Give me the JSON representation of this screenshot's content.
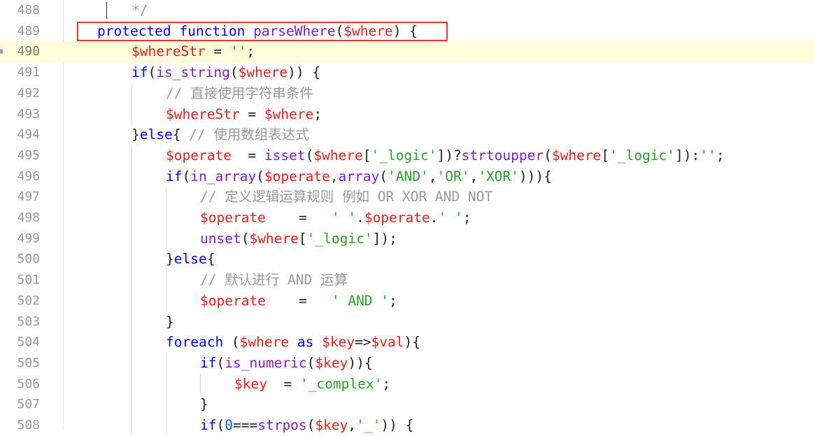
{
  "editor": {
    "current_line_index": 2,
    "lines": [
      {
        "num": "488",
        "indent": 2,
        "tokens": [
          {
            "t": "*/",
            "c": "c"
          }
        ]
      },
      {
        "num": "489",
        "indent": 1,
        "tokens": [
          {
            "t": "protected ",
            "c": "k"
          },
          {
            "t": "function ",
            "c": "k"
          },
          {
            "t": "parseWhere",
            "c": "f"
          },
          {
            "t": "(",
            "c": "p"
          },
          {
            "t": "$where",
            "c": "v"
          },
          {
            "t": ") {",
            "c": "p"
          }
        ]
      },
      {
        "num": "490",
        "indent": 2,
        "tokens": [
          {
            "t": "$whereStr",
            "c": "v"
          },
          {
            "t": " = ",
            "c": "p"
          },
          {
            "t": "''",
            "c": "s"
          },
          {
            "t": ";",
            "c": "p"
          }
        ]
      },
      {
        "num": "491",
        "indent": 2,
        "tokens": [
          {
            "t": "if",
            "c": "k"
          },
          {
            "t": "(",
            "c": "p"
          },
          {
            "t": "is_string",
            "c": "f"
          },
          {
            "t": "(",
            "c": "p"
          },
          {
            "t": "$where",
            "c": "v"
          },
          {
            "t": ")) {",
            "c": "p"
          }
        ]
      },
      {
        "num": "492",
        "indent": 3,
        "tokens": [
          {
            "t": "// 直接使用字符串条件",
            "c": "c"
          }
        ]
      },
      {
        "num": "493",
        "indent": 3,
        "tokens": [
          {
            "t": "$whereStr",
            "c": "v"
          },
          {
            "t": " = ",
            "c": "p"
          },
          {
            "t": "$where",
            "c": "v"
          },
          {
            "t": ";",
            "c": "p"
          }
        ]
      },
      {
        "num": "494",
        "indent": 2,
        "tokens": [
          {
            "t": "}",
            "c": "p"
          },
          {
            "t": "else",
            "c": "k"
          },
          {
            "t": "{ ",
            "c": "p"
          },
          {
            "t": "// 使用数组表达式",
            "c": "c"
          }
        ]
      },
      {
        "num": "495",
        "indent": 3,
        "tokens": [
          {
            "t": "$operate",
            "c": "v"
          },
          {
            "t": "  = ",
            "c": "p"
          },
          {
            "t": "isset",
            "c": "f"
          },
          {
            "t": "(",
            "c": "p"
          },
          {
            "t": "$where",
            "c": "v"
          },
          {
            "t": "[",
            "c": "p"
          },
          {
            "t": "'_logic'",
            "c": "s"
          },
          {
            "t": "])?",
            "c": "p"
          },
          {
            "t": "strtoupper",
            "c": "f"
          },
          {
            "t": "(",
            "c": "p"
          },
          {
            "t": "$where",
            "c": "v"
          },
          {
            "t": "[",
            "c": "p"
          },
          {
            "t": "'_logic'",
            "c": "s"
          },
          {
            "t": "]):",
            "c": "p"
          },
          {
            "t": "''",
            "c": "s"
          },
          {
            "t": ";",
            "c": "p"
          }
        ]
      },
      {
        "num": "496",
        "indent": 3,
        "tokens": [
          {
            "t": "if",
            "c": "k"
          },
          {
            "t": "(",
            "c": "p"
          },
          {
            "t": "in_array",
            "c": "f"
          },
          {
            "t": "(",
            "c": "p"
          },
          {
            "t": "$operate",
            "c": "v"
          },
          {
            "t": ",",
            "c": "p"
          },
          {
            "t": "array",
            "c": "f"
          },
          {
            "t": "(",
            "c": "p"
          },
          {
            "t": "'AND'",
            "c": "s"
          },
          {
            "t": ",",
            "c": "p"
          },
          {
            "t": "'OR'",
            "c": "s"
          },
          {
            "t": ",",
            "c": "p"
          },
          {
            "t": "'XOR'",
            "c": "s"
          },
          {
            "t": "))){",
            "c": "p"
          }
        ]
      },
      {
        "num": "497",
        "indent": 4,
        "tokens": [
          {
            "t": "// 定义逻辑运算规则 例如 OR XOR AND NOT",
            "c": "c"
          }
        ]
      },
      {
        "num": "498",
        "indent": 4,
        "tokens": [
          {
            "t": "$operate",
            "c": "v"
          },
          {
            "t": "    =   ",
            "c": "p"
          },
          {
            "t": "' '",
            "c": "s"
          },
          {
            "t": ".",
            "c": "p"
          },
          {
            "t": "$operate",
            "c": "v"
          },
          {
            "t": ".",
            "c": "p"
          },
          {
            "t": "' '",
            "c": "s"
          },
          {
            "t": ";",
            "c": "p"
          }
        ]
      },
      {
        "num": "499",
        "indent": 4,
        "tokens": [
          {
            "t": "unset",
            "c": "f"
          },
          {
            "t": "(",
            "c": "p"
          },
          {
            "t": "$where",
            "c": "v"
          },
          {
            "t": "[",
            "c": "p"
          },
          {
            "t": "'_logic'",
            "c": "s"
          },
          {
            "t": "]);",
            "c": "p"
          }
        ]
      },
      {
        "num": "500",
        "indent": 3,
        "tokens": [
          {
            "t": "}",
            "c": "p"
          },
          {
            "t": "else",
            "c": "k"
          },
          {
            "t": "{",
            "c": "p"
          }
        ]
      },
      {
        "num": "501",
        "indent": 4,
        "tokens": [
          {
            "t": "// 默认进行 AND 运算",
            "c": "c"
          }
        ]
      },
      {
        "num": "502",
        "indent": 4,
        "tokens": [
          {
            "t": "$operate",
            "c": "v"
          },
          {
            "t": "    =   ",
            "c": "p"
          },
          {
            "t": "' AND '",
            "c": "s"
          },
          {
            "t": ";",
            "c": "p"
          }
        ]
      },
      {
        "num": "503",
        "indent": 3,
        "tokens": [
          {
            "t": "}",
            "c": "p"
          }
        ]
      },
      {
        "num": "504",
        "indent": 3,
        "tokens": [
          {
            "t": "foreach",
            "c": "k"
          },
          {
            "t": " (",
            "c": "p"
          },
          {
            "t": "$where",
            "c": "v"
          },
          {
            "t": " as ",
            "c": "k"
          },
          {
            "t": "$key",
            "c": "v"
          },
          {
            "t": "=>",
            "c": "p"
          },
          {
            "t": "$val",
            "c": "v"
          },
          {
            "t": "){",
            "c": "p"
          }
        ]
      },
      {
        "num": "505",
        "indent": 4,
        "tokens": [
          {
            "t": "if",
            "c": "k"
          },
          {
            "t": "(",
            "c": "p"
          },
          {
            "t": "is_numeric",
            "c": "f"
          },
          {
            "t": "(",
            "c": "p"
          },
          {
            "t": "$key",
            "c": "v"
          },
          {
            "t": ")){",
            "c": "p"
          }
        ]
      },
      {
        "num": "506",
        "indent": 5,
        "tokens": [
          {
            "t": "$key",
            "c": "v"
          },
          {
            "t": "  = ",
            "c": "p"
          },
          {
            "t": "'_complex'",
            "c": "s"
          },
          {
            "t": ";",
            "c": "p"
          }
        ]
      },
      {
        "num": "507",
        "indent": 4,
        "tokens": [
          {
            "t": "}",
            "c": "p"
          }
        ]
      },
      {
        "num": "508",
        "indent": 4,
        "tokens": [
          {
            "t": "if",
            "c": "k"
          },
          {
            "t": "(",
            "c": "p"
          },
          {
            "t": "0",
            "c": "n"
          },
          {
            "t": "===",
            "c": "p"
          },
          {
            "t": "strpos",
            "c": "f"
          },
          {
            "t": "(",
            "c": "p"
          },
          {
            "t": "$key",
            "c": "v"
          },
          {
            "t": ",",
            "c": "p"
          },
          {
            "t": "'_'",
            "c": "s"
          },
          {
            "t": ")) {",
            "c": "p"
          }
        ]
      }
    ]
  }
}
